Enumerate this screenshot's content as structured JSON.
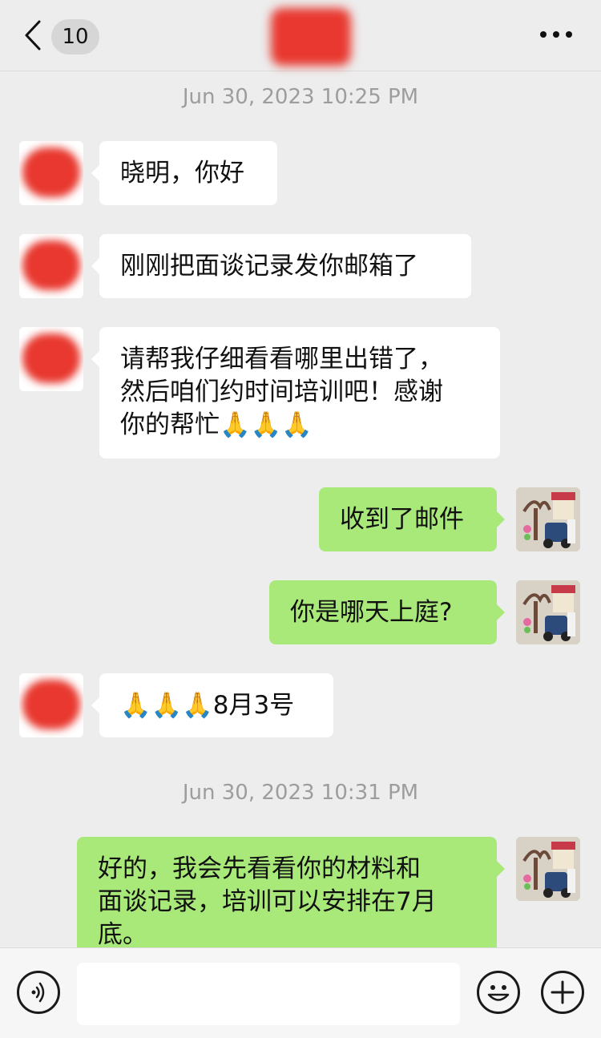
{
  "header": {
    "unread_count": "10",
    "back_icon": "chevron-left-icon",
    "more_icon": "ellipsis-icon"
  },
  "messages": {
    "timestamp_1": "Jun 30, 2023 10:25 PM",
    "m1": "晓明，你好",
    "m2": "刚刚把面谈记录发你邮箱了",
    "m3_line1": "请帮我仔细看看哪里出错了，",
    "m3_line2": "然后咱们约时间培训吧！感谢",
    "m3_line3": "你的帮忙🙏🙏🙏",
    "m4": "收到了邮件",
    "m5": "你是哪天上庭?",
    "m6": "🙏🙏🙏8月3号",
    "timestamp_2": "Jun 30, 2023 10:31 PM",
    "m7_line1": "好的，我会先看看你的材料和",
    "m7_line2": "面谈记录，培训可以安排在7月",
    "m7_line3": "底。"
  },
  "input_bar": {
    "voice_icon": "voice-icon",
    "emoji_icon": "emoji-icon",
    "plus_icon": "plus-icon",
    "input_value": ""
  },
  "colors": {
    "background": "#ededed",
    "incoming_bubble": "#ffffff",
    "outgoing_bubble": "#a9e97a",
    "redaction": "#e8382f"
  }
}
